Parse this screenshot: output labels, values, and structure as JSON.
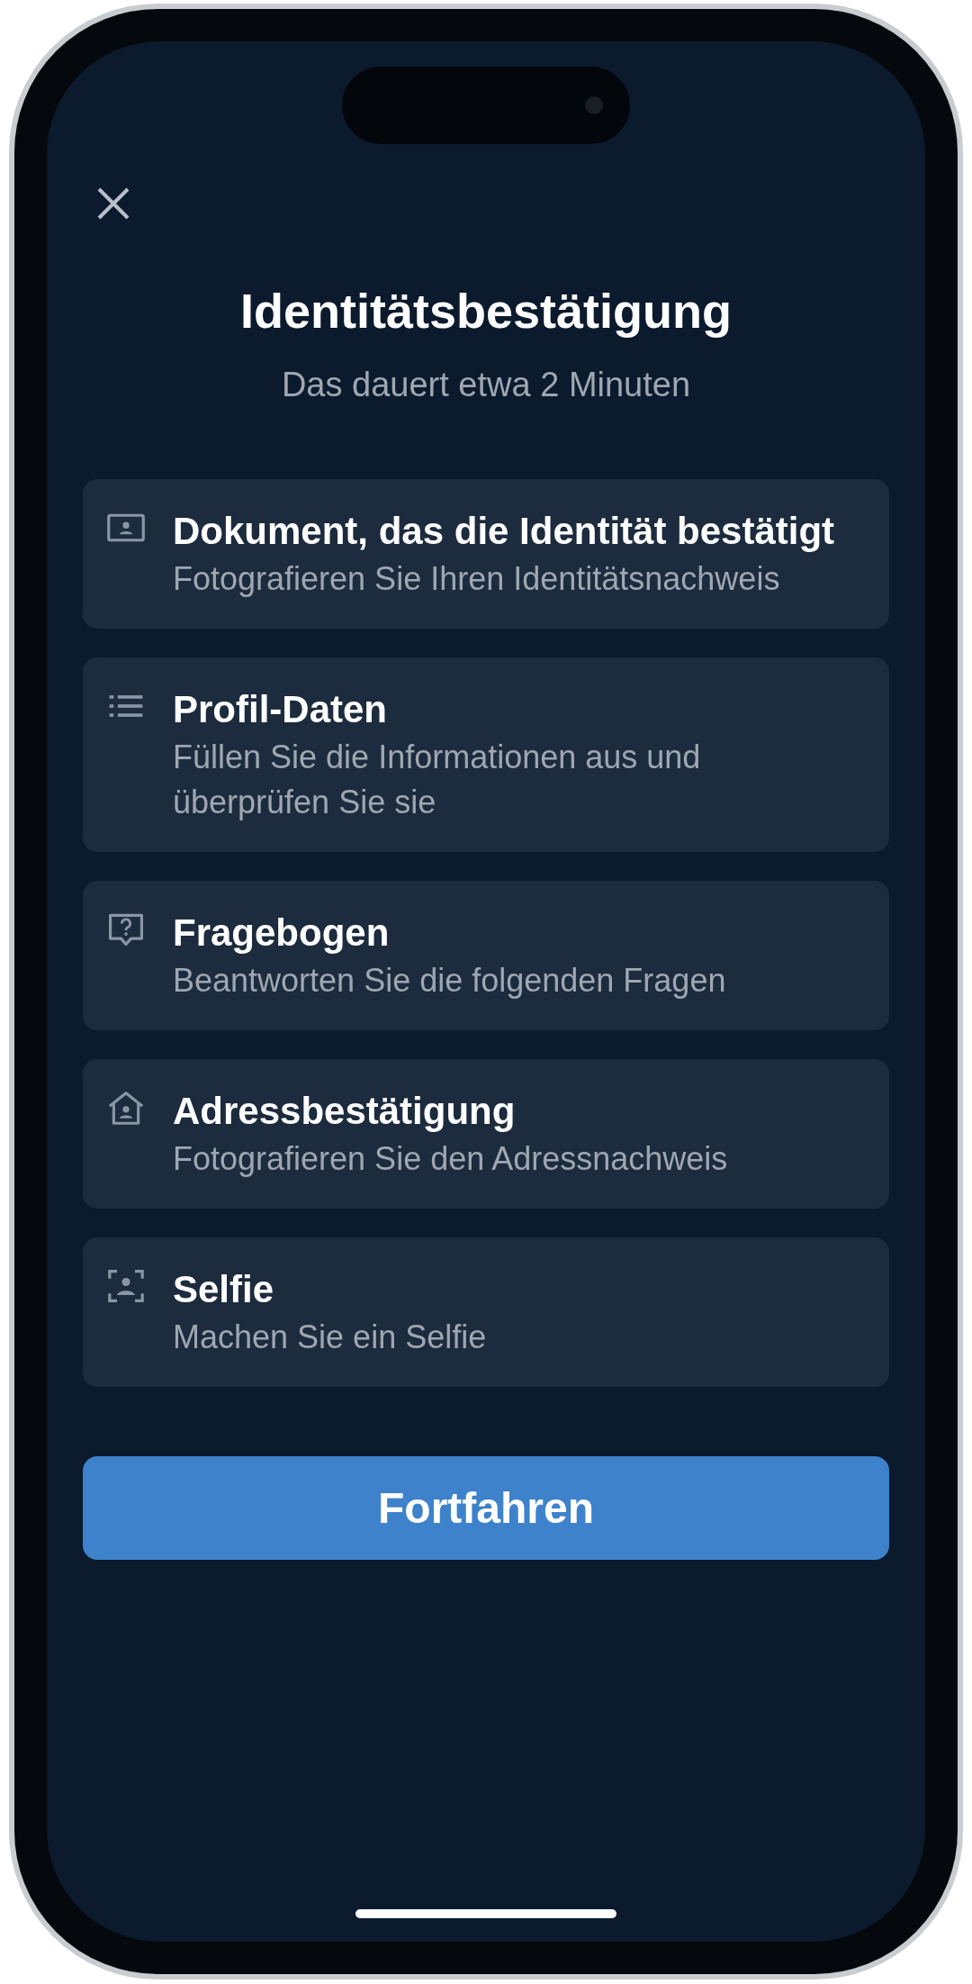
{
  "title": "Identitätsbestätigung",
  "subtitle": "Das dauert etwa 2 Minuten",
  "steps": [
    {
      "kind": "document",
      "title": "Dokument, das die Identität bestätigt",
      "description": "Fotografieren Sie Ihren Identitätsnachweis"
    },
    {
      "kind": "profile",
      "title": "Profil-Daten",
      "description": "Füllen Sie die Informationen aus und überprüfen Sie sie"
    },
    {
      "kind": "questionnaire",
      "title": "Fragebogen",
      "description": "Beantworten Sie die folgenden Fragen"
    },
    {
      "kind": "address",
      "title": "Adressbestätigung",
      "description": "Fotografieren Sie den Adressnachweis"
    },
    {
      "kind": "selfie",
      "title": "Selfie",
      "description": "Machen Sie ein Selfie"
    }
  ],
  "button": "Fortfahren"
}
